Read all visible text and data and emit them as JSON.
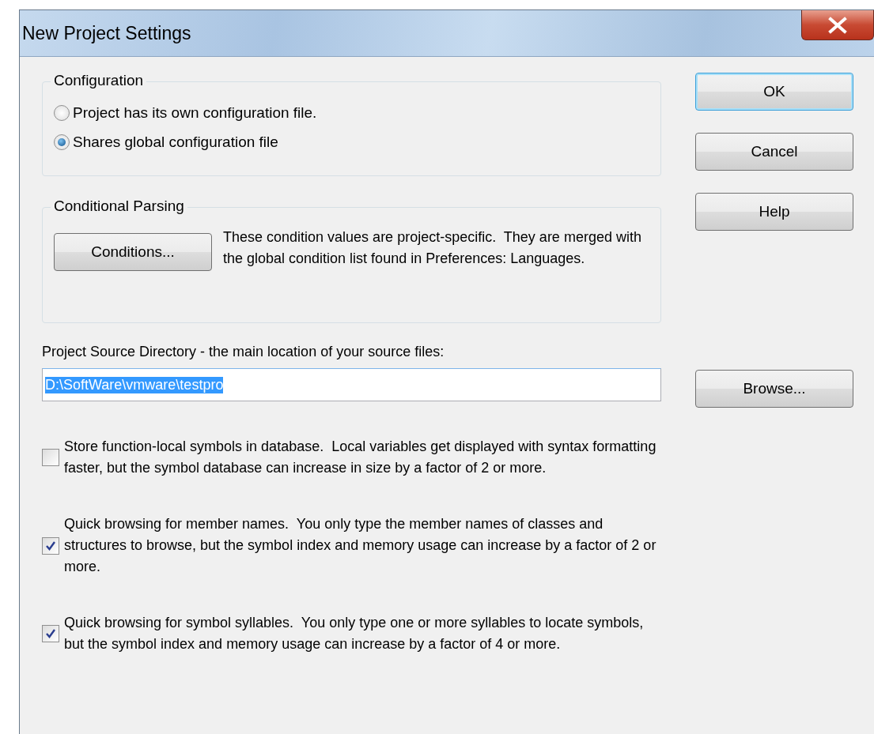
{
  "window": {
    "title": "New Project Settings"
  },
  "configuration": {
    "legend": "Configuration",
    "options": [
      {
        "label": "Project has its own configuration file.",
        "selected": false
      },
      {
        "label": "Shares global configuration file",
        "selected": true
      }
    ]
  },
  "conditional_parsing": {
    "legend": "Conditional Parsing",
    "button": "Conditions...",
    "description": "These condition values are project-specific.  They are merged with the global condition list found in Preferences: Languages."
  },
  "source_directory": {
    "label": "Project Source Directory - the main location of your source files:",
    "value": "D:\\SoftWare\\vmware\\testpro",
    "browse_button": "Browse..."
  },
  "options": [
    {
      "label": "Store function-local symbols in database.  Local variables get displayed with syntax formatting faster, but the symbol database can increase in size by a factor of 2 or more.",
      "checked": false
    },
    {
      "label": "Quick browsing for member names.  You only type the member names of classes and structures to browse, but the symbol index and memory usage can increase by a factor of 2 or more.",
      "checked": true
    },
    {
      "label": "Quick browsing for symbol syllables.  You only type one or more syllables to locate symbols, but the symbol index and memory usage can increase by a factor of 4 or more.",
      "checked": true
    }
  ],
  "buttons": [
    {
      "label": "OK",
      "default": true
    },
    {
      "label": "Cancel",
      "default": false
    },
    {
      "label": "Help",
      "default": false
    }
  ]
}
